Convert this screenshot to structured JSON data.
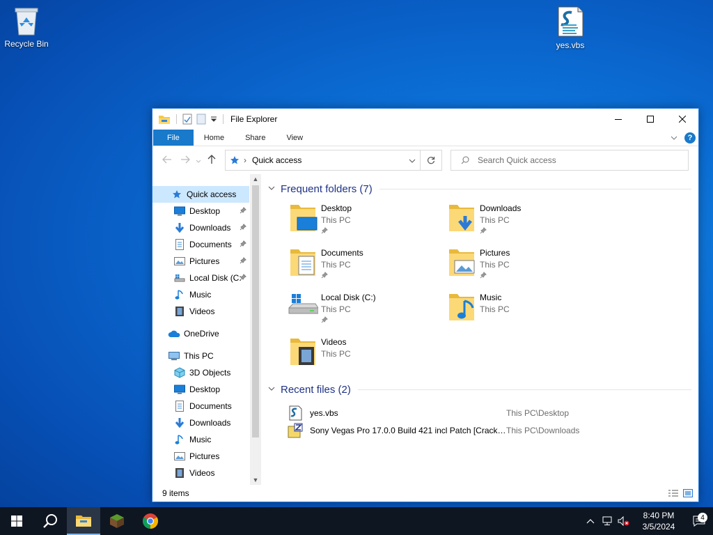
{
  "desktop": {
    "icons": [
      {
        "label": "Recycle Bin",
        "icon": "recycle-bin-icon"
      },
      {
        "label": "yes.vbs",
        "icon": "vbs-script-icon"
      }
    ]
  },
  "window": {
    "title": "File Explorer",
    "ribbon_tabs": [
      "File",
      "Home",
      "Share",
      "View"
    ],
    "address": "Quick access",
    "search_placeholder": "Search Quick access"
  },
  "nav_pane": {
    "quick_access": "Quick access",
    "pinned": [
      {
        "label": "Desktop",
        "icon": "desktop-icon",
        "pinned": true
      },
      {
        "label": "Downloads",
        "icon": "downloads-icon",
        "pinned": true
      },
      {
        "label": "Documents",
        "icon": "documents-icon",
        "pinned": true
      },
      {
        "label": "Pictures",
        "icon": "pictures-icon",
        "pinned": true
      },
      {
        "label": "Local Disk (C:",
        "icon": "local-disk-icon",
        "pinned": true
      },
      {
        "label": "Music",
        "icon": "music-icon",
        "pinned": false
      },
      {
        "label": "Videos",
        "icon": "videos-icon",
        "pinned": false
      }
    ],
    "onedrive": "OneDrive",
    "this_pc": "This PC",
    "this_pc_items": [
      {
        "label": "3D Objects",
        "icon": "3d-objects-icon"
      },
      {
        "label": "Desktop",
        "icon": "desktop-icon"
      },
      {
        "label": "Documents",
        "icon": "documents-icon"
      },
      {
        "label": "Downloads",
        "icon": "downloads-icon"
      },
      {
        "label": "Music",
        "icon": "music-icon"
      },
      {
        "label": "Pictures",
        "icon": "pictures-icon"
      },
      {
        "label": "Videos",
        "icon": "videos-icon"
      }
    ]
  },
  "frequent": {
    "header": "Frequent folders (7)",
    "items": [
      {
        "name": "Desktop",
        "location": "This PC",
        "pinned": true,
        "icon": "desktop-folder-icon"
      },
      {
        "name": "Downloads",
        "location": "This PC",
        "pinned": true,
        "icon": "downloads-folder-icon"
      },
      {
        "name": "Documents",
        "location": "This PC",
        "pinned": true,
        "icon": "documents-folder-icon"
      },
      {
        "name": "Pictures",
        "location": "This PC",
        "pinned": true,
        "icon": "pictures-folder-icon"
      },
      {
        "name": "Local Disk (C:)",
        "location": "This PC",
        "pinned": true,
        "icon": "local-disk-icon"
      },
      {
        "name": "Music",
        "location": "This PC",
        "pinned": false,
        "icon": "music-folder-icon"
      },
      {
        "name": "Videos",
        "location": "This PC",
        "pinned": false,
        "icon": "videos-folder-icon"
      }
    ]
  },
  "recent": {
    "header": "Recent files (2)",
    "items": [
      {
        "name": "yes.vbs",
        "location": "This PC\\Desktop",
        "icon": "vbs-script-icon"
      },
      {
        "name": "Sony Vegas Pro 17.0.0 Build 421 incl Patch [Cracki...",
        "location": "This PC\\Downloads",
        "icon": "archive-icon"
      }
    ]
  },
  "status": {
    "items": "9 items"
  },
  "taskbar": {
    "time": "8:40 PM",
    "date": "3/5/2024",
    "notifications": "4"
  },
  "colors": {
    "accent": "#1979ca",
    "header_text": "#1e3287",
    "selection": "#cce8ff"
  }
}
